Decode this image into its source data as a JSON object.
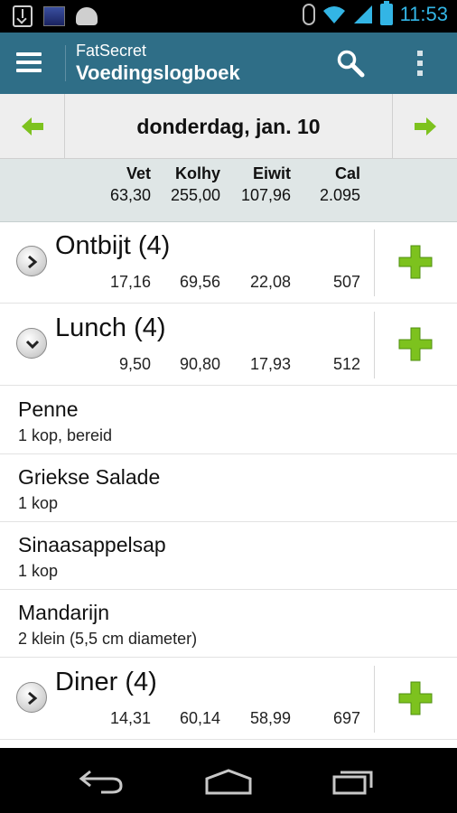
{
  "status_bar": {
    "time": "11:53"
  },
  "action_bar": {
    "app_name": "FatSecret",
    "title": "Voedingslogboek"
  },
  "date_nav": {
    "date": "donderdag, jan. 10"
  },
  "totals": {
    "headers": [
      "Vet",
      "Kolhy",
      "Eiwit",
      "Cal"
    ],
    "values": [
      "63,30",
      "255,00",
      "107,96",
      "2.095"
    ]
  },
  "meals": [
    {
      "title": "Ontbijt (4)",
      "values": [
        "17,16",
        "69,56",
        "22,08",
        "507"
      ],
      "expanded": false
    },
    {
      "title": "Lunch (4)",
      "values": [
        "9,50",
        "90,80",
        "17,93",
        "512"
      ],
      "expanded": true
    },
    {
      "title": "Diner (4)",
      "values": [
        "14,31",
        "60,14",
        "58,99",
        "697"
      ],
      "expanded": false
    }
  ],
  "lunch_items": [
    {
      "name": "Penne",
      "portion": "1 kop, bereid"
    },
    {
      "name": "Griekse Salade",
      "portion": "1 kop"
    },
    {
      "name": "Sinaasappelsap",
      "portion": "1 kop"
    },
    {
      "name": "Mandarijn",
      "portion": "2 klein (5,5 cm diameter)"
    }
  ],
  "colors": {
    "action_bar": "#2f6e87",
    "accent_green": "#7dc21e",
    "status_blue": "#33b5e5",
    "totals_bg": "#dfe6e6"
  }
}
